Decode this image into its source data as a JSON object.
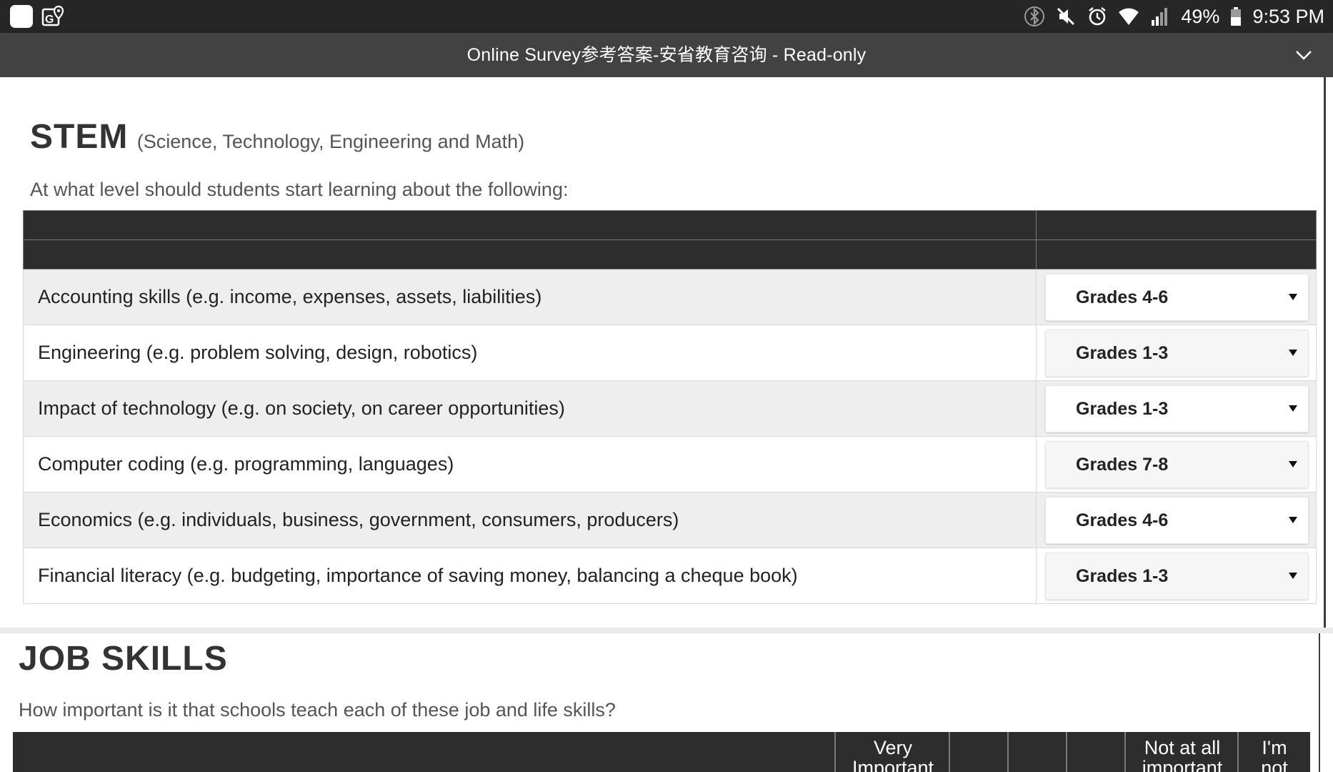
{
  "status_bar": {
    "battery": "49%",
    "time": "9:53 PM",
    "icons": [
      "app-icon",
      "maps-icon",
      "bluetooth-icon",
      "mute-icon",
      "alarm-icon",
      "wifi-icon",
      "signal-icon",
      "battery-icon"
    ]
  },
  "title_bar": {
    "title": "Online Survey参考答案-安省教育咨询 - Read-only",
    "icon": "chevron-down-icon"
  },
  "stem": {
    "title": "STEM",
    "subtitle": "(Science, Technology, Engineering and Math)",
    "question": "At what level should students start learning about the following:",
    "items": [
      {
        "label": "Accounting skills (e.g. income, expenses, assets, liabilities)",
        "value": "Grades 4-6"
      },
      {
        "label": "Engineering (e.g. problem solving, design, robotics)",
        "value": "Grades 1-3"
      },
      {
        "label": "Impact of technology (e.g. on society, on career opportunities)",
        "value": "Grades 1-3"
      },
      {
        "label": "Computer coding (e.g. programming, languages)",
        "value": "Grades 7-8"
      },
      {
        "label": "Economics (e.g. individuals, business, government, consumers, producers)",
        "value": "Grades 4-6"
      },
      {
        "label": "Financial literacy (e.g. budgeting, importance of saving money, balancing a cheque book)",
        "value": "Grades 1-3"
      }
    ]
  },
  "job_skills": {
    "title": "JOB SKILLS",
    "question": "How important is it that schools teach each of these job and life skills?",
    "columns": [
      "",
      "Very\nImportant",
      "",
      "",
      "",
      "Not at all\nimportant",
      "I'm\nnot"
    ]
  },
  "colors": {
    "status_bar_bg": "#262626",
    "title_bar_bg": "#424242",
    "table_header_bg": "#2d2d2d",
    "row_shade": "#eeeeee"
  }
}
